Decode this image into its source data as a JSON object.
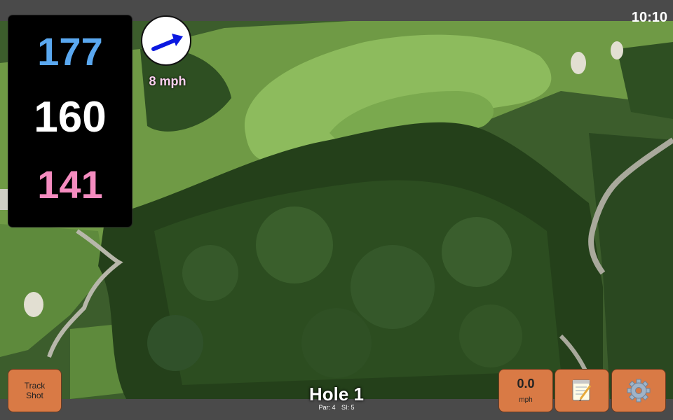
{
  "status": {
    "time": "10:10"
  },
  "distances": {
    "back": "177",
    "center": "160",
    "front": "141"
  },
  "wind": {
    "speed_label": "8 mph",
    "direction": "east-northeast"
  },
  "buttons": {
    "track_shot_line1": "Track",
    "track_shot_line2": "Shot",
    "wind_value": "0.0",
    "wind_unit": "mph",
    "notes_icon": "notepad-icon",
    "settings_icon": "gear-icon"
  },
  "hole": {
    "title": "Hole 1",
    "par": "Par: 4",
    "si": "SI: 5"
  },
  "colors": {
    "back": "#5aa8f0",
    "center": "#ffffff",
    "front": "#f58cc0",
    "button": "#d97a45"
  }
}
